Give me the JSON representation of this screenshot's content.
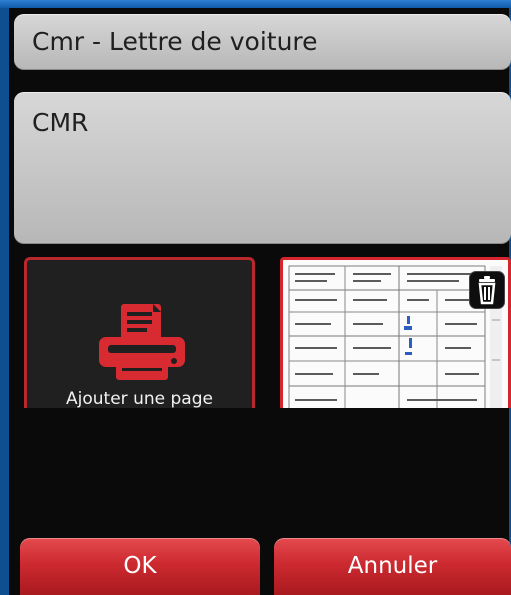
{
  "document": {
    "type_value": "Cmr - Lettre de voiture",
    "note_value": "CMR"
  },
  "pages": {
    "add_page_label": "Ajouter une page",
    "add_page_icon": "printer-icon",
    "delete_icon": "trash-icon"
  },
  "actions": {
    "ok_label": "OK",
    "cancel_label": "Annuler"
  },
  "colors": {
    "accent_red": "#cc2a30",
    "field_gray": "#c4c4c4",
    "background": "#0a0a0a",
    "top_accent_blue": "#1f6fc1"
  }
}
